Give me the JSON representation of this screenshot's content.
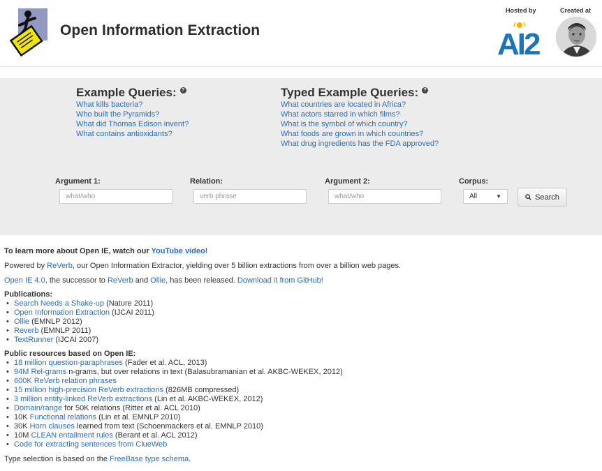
{
  "header": {
    "title": "Open Information Extraction",
    "hosted_by_label": "Hosted by",
    "created_at_label": "Created at",
    "ai2_logo_text": "AI2"
  },
  "example_queries": {
    "title": "Example Queries:",
    "items": [
      "What kills bacteria?",
      "Who built the Pyramids?",
      "What did Thomas Edison invent?",
      "What contains antioxidants?"
    ]
  },
  "typed_example_queries": {
    "title": "Typed Example Queries:",
    "items": [
      "What countries are located in Africa?",
      "What actors starred in which films?",
      "What is the symbol of which country?",
      "What foods are grown in which countries?",
      "What drug ingredients has the FDA approved?"
    ]
  },
  "search_form": {
    "arg1_label": "Argument 1:",
    "arg1_placeholder": "what/who",
    "relation_label": "Relation:",
    "relation_placeholder": "verb phrase",
    "arg2_label": "Argument 2:",
    "arg2_placeholder": "what/who",
    "corpus_label": "Corpus:",
    "corpus_value": "All",
    "search_button": "Search"
  },
  "info": {
    "learn_more_text": "To learn more about Open IE, watch our ",
    "learn_more_link": "YouTube video!",
    "powered_prefix": "Powered by ",
    "powered_link": "ReVerb",
    "powered_suffix": ", our Open Information Extractor, yielding over 5 billion extractions from over a billion web pages.",
    "openie4_link": "Open IE 4.0",
    "openie4_mid1": ", the successor to ",
    "openie4_reverb": "ReVerb",
    "openie4_mid2": " and ",
    "openie4_ollie": "Ollie",
    "openie4_mid3": ", has been released. ",
    "openie4_download": "Download it from GitHub!",
    "publications_heading": "Publications:",
    "publications": [
      {
        "link": "Search Needs a Shake-up",
        "text": " (Nature 2011)"
      },
      {
        "link": "Open Information Extraction",
        "text": " (IJCAI 2011)"
      },
      {
        "link": "Ollie",
        "text": " (EMNLP 2012)"
      },
      {
        "link": "Reverb",
        "text": " (EMNLP 2011)"
      },
      {
        "link": "TextRunner",
        "text": " (IJCAI 2007)"
      }
    ],
    "resources_heading": "Public resources based on Open IE:",
    "resources": [
      {
        "pre": "",
        "link": "18 million question-paraphrases",
        "text": " (Fader et al. ACL, 2013)"
      },
      {
        "pre": "",
        "link": "94M Rel-grams",
        "text": " n-grams, but over relations in text (Balasubramanian et al. AKBC-WEKEX, 2012)"
      },
      {
        "pre": "",
        "link": "600K ReVerb relation phrases",
        "text": ""
      },
      {
        "pre": "",
        "link": "15 million high-precision ReVerb extractions",
        "text": " (826MB compressed)"
      },
      {
        "pre": "",
        "link": "3 million entity-linked ReVerb extractions",
        "text": " (Lin et al. AKBC-WEKEX, 2012)"
      },
      {
        "pre": "",
        "link": "Domain/range",
        "text": " for 50K relations (Ritter et al. ACL 2010)"
      },
      {
        "pre": "10K ",
        "link": "Functional relations",
        "text": " (Lin et al. EMNLP 2010)"
      },
      {
        "pre": "30K ",
        "link": "Horn clauses",
        "text": " learned from text (Schoenmackers et al. EMNLP 2010)"
      },
      {
        "pre": "10M ",
        "link": "CLEAN entailment rules",
        "text": " (Berant et al. ACL 2012)"
      },
      {
        "pre": "",
        "link": "Code for extracting sentences from ClueWeb",
        "text": ""
      }
    ],
    "type_selection_prefix": "Type selection is based on the ",
    "type_selection_link": "FreeBase type schema",
    "type_selection_suffix": "."
  },
  "colors": {
    "link": "#2a6ebb",
    "panel_bg": "#ececec",
    "ai2_blue": "#1b75bb",
    "logo_yellow": "#f2e600"
  },
  "icons": [
    "runner-with-sign-logo",
    "help-icon",
    "search-icon",
    "chevron-down-icon",
    "ai2-logo",
    "avatar-photo"
  ]
}
